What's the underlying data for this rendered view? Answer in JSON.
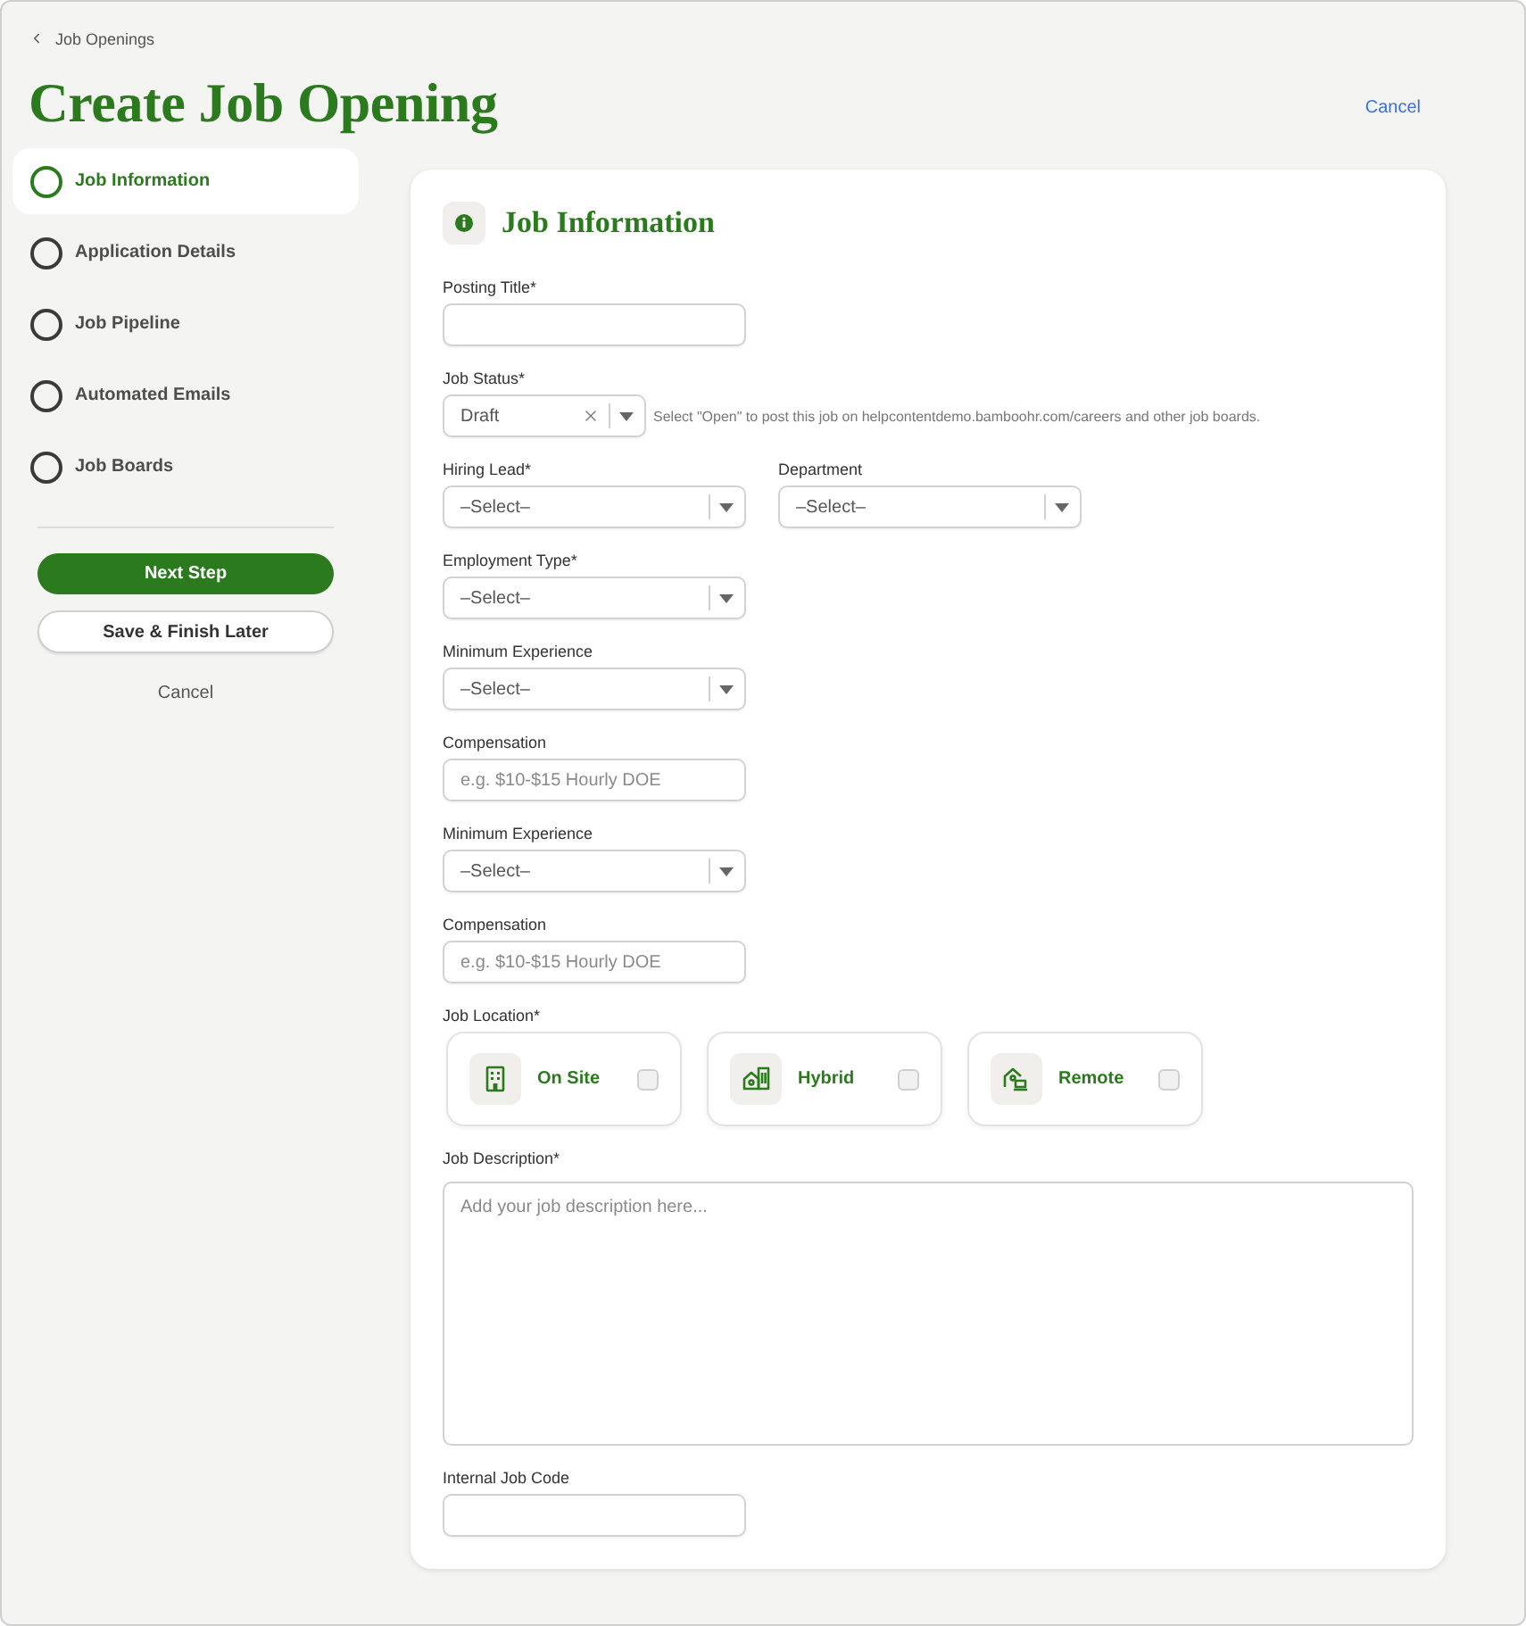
{
  "breadcrumb": "Job Openings",
  "page_title": "Create Job Opening",
  "header_link": "Cancel",
  "steps": [
    {
      "label": "Job Information",
      "selected": true
    },
    {
      "label": "Application Details",
      "selected": false
    },
    {
      "label": "Job Pipeline",
      "selected": false
    },
    {
      "label": "Automated Emails",
      "selected": false
    },
    {
      "label": "Job Boards",
      "selected": false
    }
  ],
  "sidebar_actions": [
    {
      "kind": "primary",
      "label": "Next Step"
    },
    {
      "kind": "secondary",
      "label": "Save & Finish Later"
    },
    {
      "kind": "link",
      "label": "Cancel"
    }
  ],
  "form": {
    "title": "Job Information",
    "fields": [
      {
        "kind": "text",
        "label": "Posting Title*"
      },
      {
        "kind": "status",
        "label": "Job Status*",
        "value": "Draft",
        "hint": "Select \"Open\" to post this job on helpcontentdemo.bamboohr.com/careers and other job boards."
      },
      {
        "kind": "pair",
        "fields": [
          {
            "label": "Hiring Lead*",
            "value": "–Select–"
          },
          {
            "label": "Department",
            "value": "–Select–"
          }
        ]
      },
      {
        "kind": "select",
        "label": "Employment Type*",
        "value": "–Select–"
      },
      {
        "kind": "select",
        "label": "Minimum Experience",
        "value": "–Select–"
      },
      {
        "kind": "text",
        "label": "Compensation",
        "placeholder": "e.g. $10-$15 Hourly DOE"
      },
      {
        "kind": "select",
        "label": "Minimum Experience",
        "value": "–Select–"
      },
      {
        "kind": "text",
        "label": "Compensation",
        "placeholder": "e.g. $10-$15 Hourly DOE"
      },
      {
        "kind": "location",
        "label": "Job Location*",
        "options": [
          {
            "kind": "onsite",
            "label": "On Site",
            "checked": false
          },
          {
            "kind": "hybrid",
            "label": "Hybrid",
            "checked": false
          },
          {
            "kind": "remote",
            "label": "Remote",
            "checked": false
          }
        ]
      },
      {
        "kind": "textarea",
        "label": "Job Description*",
        "placeholder": "Add your job description here..."
      },
      {
        "kind": "text",
        "label": "Internal Job Code"
      }
    ]
  }
}
